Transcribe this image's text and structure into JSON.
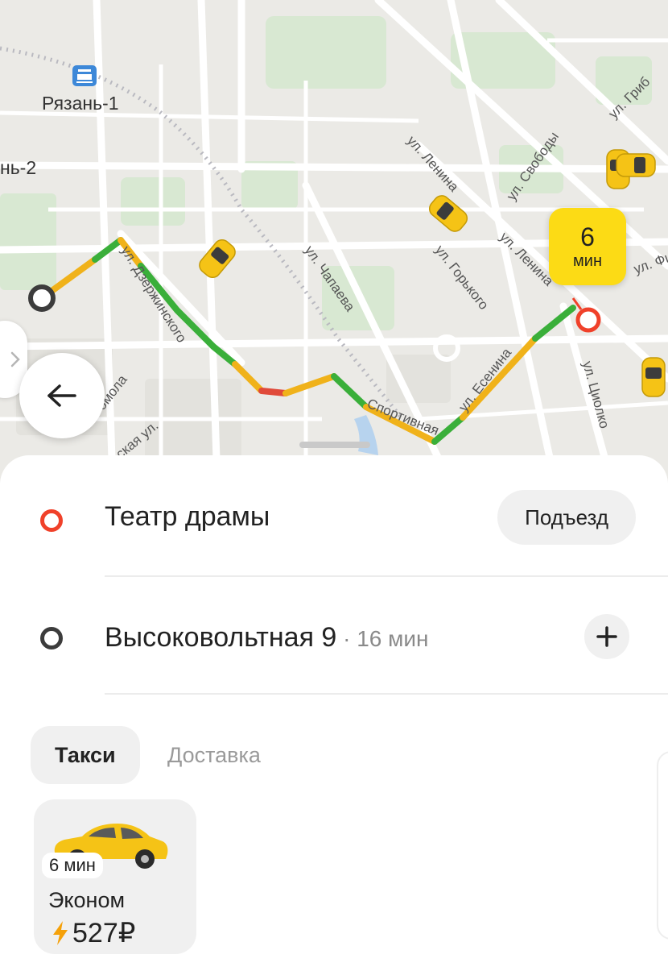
{
  "map": {
    "station_label": "Рязань-1",
    "station2_label": "нь-2",
    "streets": [
      "ул. Ленина",
      "ул. Свободы",
      "ул. Гриб",
      "ул. Горького",
      "ул. Ленина",
      "ул. Фи",
      "ул. Чапаева",
      "ул. Дзержинского",
      "ул. Есенина",
      "ул. Циолко",
      "Спортивная",
      "омола",
      "ская ул."
    ]
  },
  "eta_bubble": {
    "value": "6",
    "unit": "мин"
  },
  "route": {
    "destination": {
      "title": "Театр драмы",
      "action_label": "Подъезд"
    },
    "origin": {
      "title": "Высоковольтная 9",
      "duration": "16 мин"
    }
  },
  "tabs": [
    {
      "label": "Такси",
      "active": true
    },
    {
      "label": "Доставка",
      "active": false
    }
  ],
  "tariffs": [
    {
      "eta": "6 мин",
      "name": "Эконом",
      "price": "527₽",
      "surge_icon": "lightning-icon"
    }
  ],
  "colors": {
    "accent_yellow": "#fcdb15",
    "destination_red": "#f0412a",
    "origin_dark": "#3c3c3c",
    "traffic_green": "#3aaf3a",
    "traffic_yellow": "#f0b21a",
    "traffic_red": "#e04a3a"
  }
}
